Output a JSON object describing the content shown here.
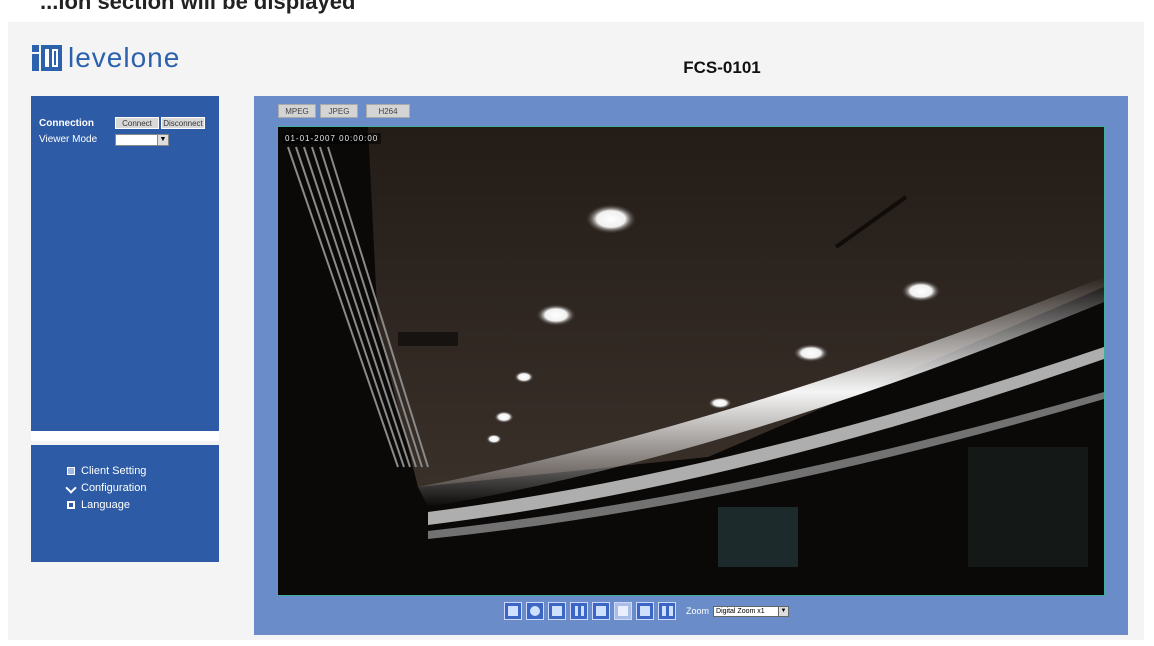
{
  "header": {
    "cut_heading": "...ion section will be displayed",
    "logo_text": "levelone",
    "model_title": "FCS-0101"
  },
  "sidebar": {
    "connection_label": "Connection",
    "connection_buttons": [
      "Connect",
      "Disconnect"
    ],
    "viewer_label": "Viewer Mode",
    "viewer_value": "",
    "menu": [
      {
        "label": "Client Setting",
        "icon": "settings-icon"
      },
      {
        "label": "Configuration",
        "icon": "wrench-icon"
      },
      {
        "label": "Language",
        "icon": "language-icon"
      }
    ]
  },
  "video": {
    "tabs": [
      "MPEG",
      "JPEG",
      "H264"
    ],
    "timestamp": "01-01-2007 00:00:00",
    "zoom_label": "Zoom",
    "zoom_value": "Digital Zoom x1"
  },
  "toolbar_icons": [
    "snapshot-icon",
    "zoom-icon",
    "record-icon",
    "pause-icon",
    "stop-icon",
    "pan-icon",
    "talk-icon",
    "mute-icon"
  ],
  "colors": {
    "brand_blue": "#2c62ad",
    "sidebar_blue": "#2d5ba6",
    "panel_blue": "#6a8dc9"
  }
}
